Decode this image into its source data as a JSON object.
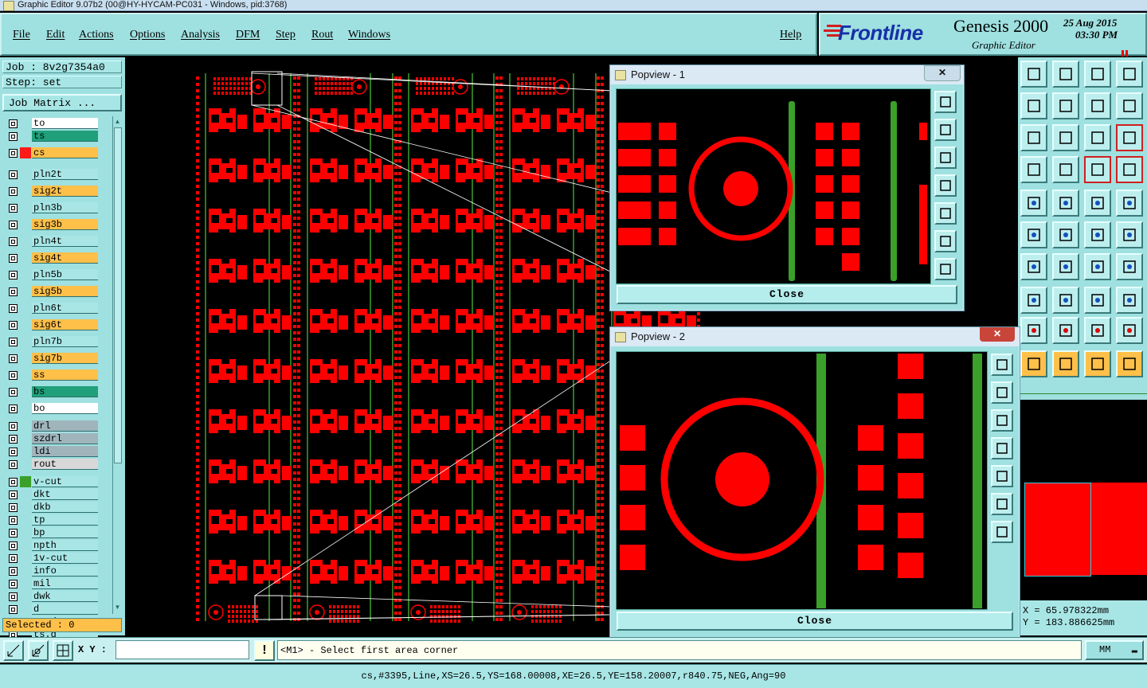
{
  "window": {
    "title": "Graphic Editor 9.07b2 (00@HY-HYCAM-PC031 - Windows, pid:3768)"
  },
  "menu": [
    "File",
    "Edit",
    "Actions",
    "Options",
    "Analysis",
    "DFM",
    "Step",
    "Rout",
    "Windows"
  ],
  "help_label": "Help",
  "brand": {
    "logo": "Frontline",
    "product": "Genesis 2000",
    "subtitle": "Graphic Editor",
    "date": "25 Aug 2015",
    "time": "03:30 PM"
  },
  "job": {
    "job_label": "Job : 8v2g7354a0",
    "step_label": "Step: set",
    "matrix_button": "Job Matrix ..."
  },
  "layers": [
    {
      "name": "to",
      "color": "#ffffff",
      "swatch": ""
    },
    {
      "name": "ts",
      "color": "#1fa07a",
      "swatch": ""
    },
    {
      "name": "cs",
      "color": "#ffc04a",
      "swatch": "#ff1a1a"
    },
    {
      "name": "pln2t",
      "color": "#a8e6e6",
      "swatch": ""
    },
    {
      "name": "sig2t",
      "color": "#ffc04a",
      "swatch": ""
    },
    {
      "name": "pln3b",
      "color": "#a8e6e6",
      "swatch": ""
    },
    {
      "name": "sig3b",
      "color": "#ffc04a",
      "swatch": ""
    },
    {
      "name": "pln4t",
      "color": "#a8e6e6",
      "swatch": ""
    },
    {
      "name": "sig4t",
      "color": "#ffc04a",
      "swatch": ""
    },
    {
      "name": "pln5b",
      "color": "#a8e6e6",
      "swatch": ""
    },
    {
      "name": "sig5b",
      "color": "#ffc04a",
      "swatch": ""
    },
    {
      "name": "pln6t",
      "color": "#a8e6e6",
      "swatch": ""
    },
    {
      "name": "sig6t",
      "color": "#ffc04a",
      "swatch": ""
    },
    {
      "name": "pln7b",
      "color": "#a8e6e6",
      "swatch": ""
    },
    {
      "name": "sig7b",
      "color": "#ffc04a",
      "swatch": ""
    },
    {
      "name": "ss",
      "color": "#ffc04a",
      "swatch": ""
    },
    {
      "name": "bs",
      "color": "#1fa07a",
      "swatch": ""
    },
    {
      "name": "bo",
      "color": "#ffffff",
      "swatch": ""
    },
    {
      "name": "drl",
      "color": "#a0b4bc",
      "swatch": ""
    },
    {
      "name": "szdrl",
      "color": "#a0b4bc",
      "swatch": ""
    },
    {
      "name": "ldi",
      "color": "#a0b4bc",
      "swatch": ""
    },
    {
      "name": "rout",
      "color": "#d8d8d8",
      "swatch": ""
    },
    {
      "name": "v-cut",
      "color": "#a8e6e6",
      "swatch": "#3aa02a"
    },
    {
      "name": "dkt",
      "color": "#a8e6e6",
      "swatch": ""
    },
    {
      "name": "dkb",
      "color": "#a8e6e6",
      "swatch": ""
    },
    {
      "name": "tp",
      "color": "#a8e6e6",
      "swatch": ""
    },
    {
      "name": "bp",
      "color": "#a8e6e6",
      "swatch": ""
    },
    {
      "name": "npth",
      "color": "#a8e6e6",
      "swatch": ""
    },
    {
      "name": "1v-cut",
      "color": "#a8e6e6",
      "swatch": ""
    },
    {
      "name": "info",
      "color": "#a8e6e6",
      "swatch": ""
    },
    {
      "name": "mil",
      "color": "#a8e6e6",
      "swatch": ""
    },
    {
      "name": "dwk",
      "color": "#a8e6e6",
      "swatch": ""
    },
    {
      "name": "d",
      "color": "#a8e6e6",
      "swatch": ""
    },
    {
      "name": "to.d",
      "color": "#a8e6e6",
      "swatch": ""
    },
    {
      "name": "ts.d",
      "color": "#a8e6e6",
      "swatch": ""
    }
  ],
  "selected_label": "Selected : 0",
  "popup1": {
    "title": "Popview - 1",
    "close_label": "Close"
  },
  "popup2": {
    "title": "Popview - 2",
    "close_label": "Close"
  },
  "coords": {
    "x": "X = 65.978322mm",
    "y": "Y = 183.886625mm"
  },
  "status": {
    "xy_label": "X Y :",
    "xy_value": "",
    "prompt": "<M1> - Select first area corner",
    "units": "MM"
  },
  "feature_info": "cs,#3395,Line,XS=26.5,YS=168.00008,XE=26.5,YE=158.20007,r840.75,NEG,Ang=90",
  "colors": {
    "layer_red": "#ff0000",
    "vcut_green": "#3aa02a",
    "panel_cyan": "#9fe0e0"
  }
}
